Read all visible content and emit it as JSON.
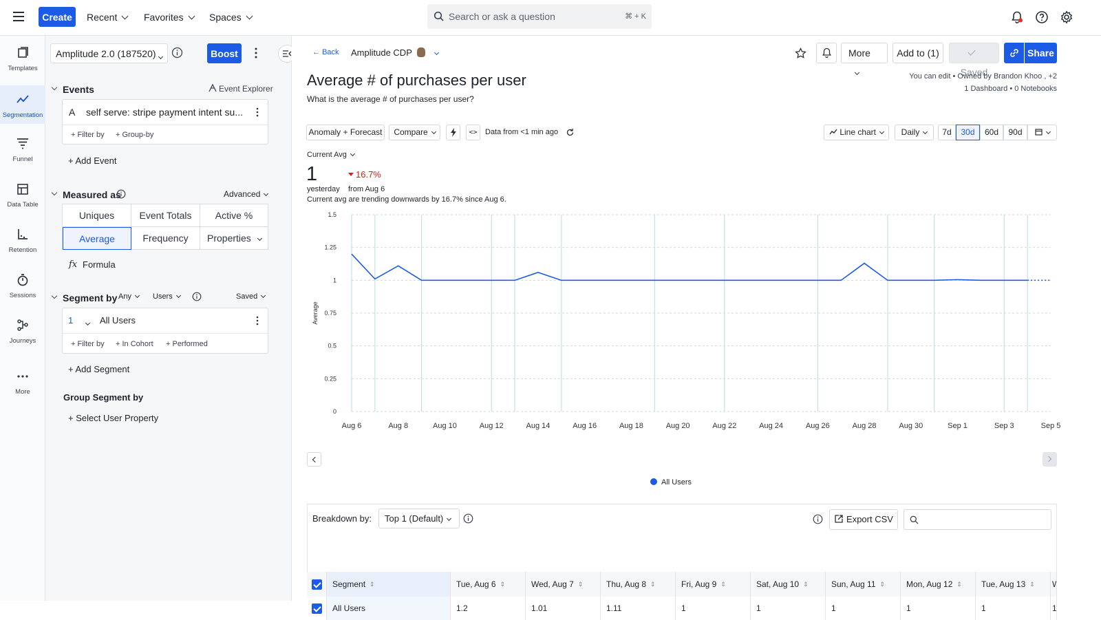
{
  "topbar": {
    "create_label": "Create",
    "recent_label": "Recent",
    "favorites_label": "Favorites",
    "spaces_label": "Spaces",
    "search_placeholder": "Search or ask a question",
    "search_shortcut": "⌘ + K"
  },
  "leftnav": {
    "items": [
      {
        "label": "Templates",
        "icon": "templates-icon"
      },
      {
        "label": "Segmentation",
        "icon": "segmentation-icon",
        "active": true
      },
      {
        "label": "Funnel",
        "icon": "funnel-icon"
      },
      {
        "label": "Data Table",
        "icon": "data-table-icon"
      },
      {
        "label": "Retention",
        "icon": "retention-icon"
      },
      {
        "label": "Sessions",
        "icon": "sessions-icon"
      },
      {
        "label": "Journeys",
        "icon": "journeys-icon"
      },
      {
        "label": "More",
        "icon": "more-icon"
      }
    ]
  },
  "sidepanel": {
    "project_label": "Amplitude 2.0 (187520)",
    "boost_label": "Boost",
    "events_title": "Events",
    "event_explorer_label": "Event Explorer",
    "event_letter": "A",
    "event_name": "self serve: stripe payment intent su...",
    "filter_by_label": "+ Filter by",
    "group_by_label": "+ Group-by",
    "add_event_label": "+ Add Event",
    "measured_as_title": "Measured as",
    "advanced_label": "Advanced",
    "measure_options": [
      "Uniques",
      "Event Totals",
      "Active %",
      "Average",
      "Frequency",
      "Properties"
    ],
    "selected_measure": "Average",
    "formula_icon_label": "fx",
    "formula_label": "Formula",
    "segment_by_title": "Segment by",
    "any_label": "Any",
    "users_label": "Users",
    "saved_label": "Saved",
    "segment_number": "1",
    "segment_name": "All Users",
    "seg_filter_by_label": "+ Filter by",
    "in_cohort_label": "+ In Cohort",
    "performed_label": "+ Performed",
    "add_segment_label": "+ Add Segment",
    "group_segment_title": "Group Segment by",
    "select_user_property_label": "+ Select User Property"
  },
  "header": {
    "back_label": "Back",
    "space_name": "Amplitude CDP",
    "more_label": "More",
    "add_to_label": "Add to (1)",
    "saved_label": "Saved",
    "share_label": "Share",
    "chart_title": "Average # of purchases per user",
    "chart_description": "What is the average # of purchases per user?",
    "ownership_text": "You can edit • Owned by Brandon Khoo , +2",
    "dashboards_text": "1 Dashboard • 0 Notebooks"
  },
  "controls": {
    "anomaly_label": "Anomaly + Forecast",
    "compare_label": "Compare",
    "data_freshness": "Data from <1 min ago",
    "chart_type_label": "Line chart",
    "interval_label": "Daily",
    "ranges": [
      "7d",
      "30d",
      "60d",
      "90d"
    ],
    "selected_range": "30d"
  },
  "summary": {
    "metric_label": "Current Avg",
    "value": "1",
    "value_caption": "yesterday",
    "change": "16.7%",
    "change_caption": "from Aug 6",
    "trend_text": "Current avg are trending downwards by 16.7% since Aug 6."
  },
  "chart_data": {
    "type": "line",
    "ylabel": "Average",
    "ylim": [
      0,
      1.5
    ],
    "yticks": [
      "1.5",
      "1.25",
      "1",
      "0.75",
      "0.5",
      "0.25",
      "0"
    ],
    "xticks": [
      "Aug 6",
      "Aug 8",
      "Aug 10",
      "Aug 12",
      "Aug 14",
      "Aug 16",
      "Aug 18",
      "Aug 20",
      "Aug 22",
      "Aug 24",
      "Aug 26",
      "Aug 28",
      "Aug 30",
      "Sep 1",
      "Sep 3",
      "Sep 5"
    ],
    "x": [
      "Aug 6",
      "Aug 7",
      "Aug 8",
      "Aug 9",
      "Aug 10",
      "Aug 11",
      "Aug 12",
      "Aug 13",
      "Aug 14",
      "Aug 15",
      "Aug 16",
      "Aug 17",
      "Aug 18",
      "Aug 19",
      "Aug 20",
      "Aug 21",
      "Aug 22",
      "Aug 23",
      "Aug 24",
      "Aug 25",
      "Aug 26",
      "Aug 27",
      "Aug 28",
      "Aug 29",
      "Aug 30",
      "Aug 31",
      "Sep 1",
      "Sep 2",
      "Sep 3",
      "Sep 4"
    ],
    "series": [
      {
        "name": "All Users",
        "color": "#1c5be6",
        "values": [
          1.2,
          1.01,
          1.11,
          1,
          1,
          1,
          1,
          1,
          1.06,
          1,
          1,
          1,
          1,
          1,
          1,
          1,
          1,
          1,
          1,
          1,
          1,
          1,
          1.13,
          1,
          1,
          1,
          1.005,
          1,
          1,
          1
        ],
        "partial_from_index": 29
      }
    ],
    "grid": true,
    "legend": "bottom-center"
  },
  "breakdown": {
    "label": "Breakdown by:",
    "selected": "Top 1 (Default)",
    "export_label": "Export CSV",
    "columns": [
      "Segment",
      "Tue, Aug 6",
      "Wed, Aug 7",
      "Thu, Aug 8",
      "Fri, Aug 9",
      "Sat, Aug 10",
      "Sun, Aug 11",
      "Mon, Aug 12",
      "Tue, Aug 13",
      "W"
    ],
    "rows": [
      {
        "cells": [
          "All Users",
          "1.2",
          "1.01",
          "1.11",
          "1",
          "1",
          "1",
          "1",
          "1",
          "1"
        ]
      }
    ]
  }
}
